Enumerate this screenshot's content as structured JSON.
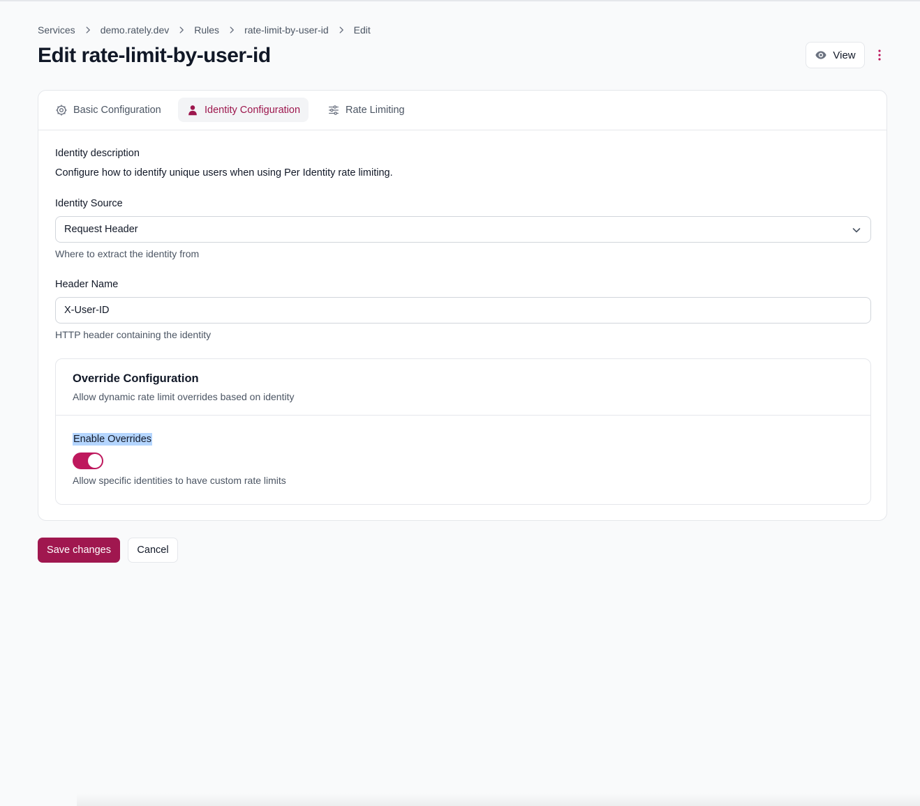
{
  "breadcrumb": {
    "items": [
      "Services",
      "demo.rately.dev",
      "Rules",
      "rate-limit-by-user-id",
      "Edit"
    ]
  },
  "header": {
    "title": "Edit rate-limit-by-user-id",
    "view_label": "View"
  },
  "tabs": [
    {
      "label": "Basic Configuration",
      "icon": "gear-icon",
      "active": false
    },
    {
      "label": "Identity Configuration",
      "icon": "user-icon",
      "active": true
    },
    {
      "label": "Rate Limiting",
      "icon": "sliders-icon",
      "active": false
    }
  ],
  "form": {
    "identity_label": "Identity description",
    "identity_description": "Configure how to identify unique users when using Per Identity rate limiting.",
    "source_label": "Identity Source",
    "source_value": "Request Header",
    "source_help": "Where to extract the identity from",
    "header_label": "Header Name",
    "header_value": "X-User-ID",
    "header_help": "HTTP header containing the identity"
  },
  "override": {
    "title": "Override Configuration",
    "description": "Allow dynamic rate limit overrides based on identity",
    "enable_label": "Enable Overrides",
    "enabled": true,
    "enable_help": "Allow specific identities to have custom rate limits"
  },
  "actions": {
    "save_label": "Save changes",
    "cancel_label": "Cancel"
  },
  "colors": {
    "accent": "#a0174f",
    "accent_text": "#9d174d",
    "selection": "#b4d5fe"
  }
}
